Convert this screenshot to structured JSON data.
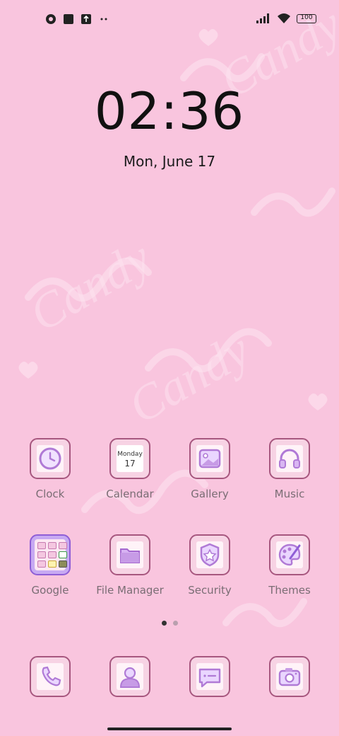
{
  "status_bar": {
    "battery": "100",
    "icons": [
      "notification-app-icon",
      "square-notification-icon",
      "upload-icon",
      "more-dots-icon",
      "signal-icon",
      "wifi-icon",
      "battery-icon"
    ]
  },
  "lock": {
    "time": "02:36",
    "date": "Mon, June 17"
  },
  "wallpaper": {
    "text": "Candy"
  },
  "apps_row1": [
    {
      "label": "Clock",
      "icon": "clock-icon"
    },
    {
      "label": "Calendar",
      "icon": "calendar-icon",
      "cal_day": "Monday",
      "cal_date": "17"
    },
    {
      "label": "Gallery",
      "icon": "gallery-icon"
    },
    {
      "label": "Music",
      "icon": "headphones-icon"
    }
  ],
  "apps_row2": [
    {
      "label": "Google",
      "icon": "google-folder-icon"
    },
    {
      "label": "File Manager",
      "icon": "folder-icon"
    },
    {
      "label": "Security",
      "icon": "shield-icon"
    },
    {
      "label": "Themes",
      "icon": "palette-icon"
    }
  ],
  "page_indicator": {
    "pages": 2,
    "current": 1
  },
  "dock": [
    {
      "icon": "phone-icon"
    },
    {
      "icon": "contacts-icon"
    },
    {
      "icon": "messages-icon"
    },
    {
      "icon": "camera-icon"
    }
  ],
  "colors": {
    "background": "#f9c5de",
    "tile_border": "#a7577f",
    "tile_fill": "#f7d3e4",
    "icon_purple": "#b07ad6",
    "label": "#7a6d74"
  }
}
